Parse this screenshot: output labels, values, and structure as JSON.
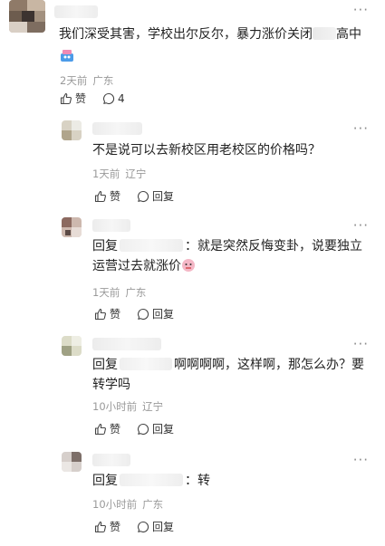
{
  "comments": [
    {
      "text": "我们深受其害，学校出尔反尔，暴力涨价关闭",
      "text_tail": "高中",
      "time": "2天前",
      "location": "广东",
      "like_label": "赞",
      "reply_count": "4"
    }
  ],
  "replies": [
    {
      "text": "不是说可以去新校区用老校区的价格吗？",
      "time": "1天前",
      "location": "辽宁",
      "like_label": "赞",
      "reply_label": "回复"
    },
    {
      "prefix": "回复",
      "text": "：就是突然反悔变卦，说要独立",
      "text_line2": "运营过去就涨价",
      "time": "1天前",
      "location": "广东",
      "like_label": "赞",
      "reply_label": "回复"
    },
    {
      "prefix": "回复",
      "text": "啊啊啊啊，这样啊，那怎么办？要",
      "text_line2": "转学吗",
      "time": "10小时前",
      "location": "辽宁",
      "like_label": "赞",
      "reply_label": "回复"
    },
    {
      "prefix": "回复",
      "text": "：转",
      "time": "10小时前",
      "location": "广东",
      "like_label": "赞",
      "reply_label": "回复"
    }
  ],
  "more_glyph": "···"
}
